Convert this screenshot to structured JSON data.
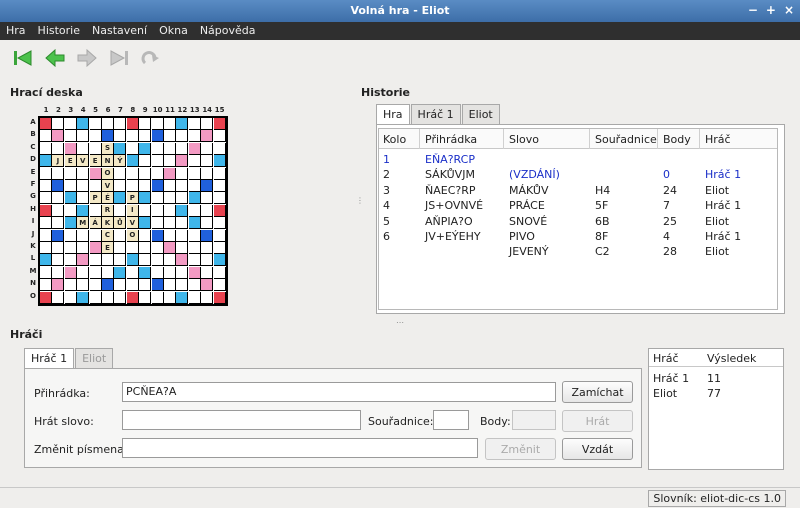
{
  "window": {
    "title": "Volná hra - Eliot"
  },
  "menu": [
    "Hra",
    "Historie",
    "Nastavení",
    "Okna",
    "Nápověda"
  ],
  "board_title": "Hrací deska",
  "history_title": "Historie",
  "players_title": "Hráči",
  "board": {
    "col_labels": [
      "1",
      "2",
      "3",
      "4",
      "5",
      "6",
      "7",
      "8",
      "9",
      "10",
      "11",
      "12",
      "13",
      "14",
      "15"
    ],
    "row_labels": [
      "A",
      "B",
      "C",
      "D",
      "E",
      "F",
      "G",
      "H",
      "I",
      "J",
      "K",
      "L",
      "M",
      "N",
      "O"
    ],
    "colors": {
      "tw": "#e8424f",
      "dw": "#f39ac3",
      "tl": "#2060dc",
      "dl": "#3fb6ea",
      "letter": "#f4e9c7"
    },
    "letters": [
      {
        "r": 2,
        "c": 5,
        "ch": "S"
      },
      {
        "r": 3,
        "c": 1,
        "ch": "J"
      },
      {
        "r": 3,
        "c": 2,
        "ch": "E"
      },
      {
        "r": 3,
        "c": 3,
        "ch": "V"
      },
      {
        "r": 3,
        "c": 4,
        "ch": "E"
      },
      {
        "r": 3,
        "c": 5,
        "ch": "N"
      },
      {
        "r": 3,
        "c": 6,
        "ch": "Ý"
      },
      {
        "r": 4,
        "c": 5,
        "ch": "O"
      },
      {
        "r": 5,
        "c": 5,
        "ch": "V"
      },
      {
        "r": 6,
        "c": 4,
        "ch": "P"
      },
      {
        "r": 6,
        "c": 5,
        "ch": "É"
      },
      {
        "r": 6,
        "c": 7,
        "ch": "P"
      },
      {
        "r": 7,
        "c": 5,
        "ch": "R"
      },
      {
        "r": 7,
        "c": 7,
        "ch": "I"
      },
      {
        "r": 8,
        "c": 3,
        "ch": "M"
      },
      {
        "r": 8,
        "c": 4,
        "ch": "Á"
      },
      {
        "r": 8,
        "c": 5,
        "ch": "K"
      },
      {
        "r": 8,
        "c": 6,
        "ch": "Ů"
      },
      {
        "r": 8,
        "c": 7,
        "ch": "V"
      },
      {
        "r": 9,
        "c": 5,
        "ch": "C"
      },
      {
        "r": 9,
        "c": 7,
        "ch": "O"
      },
      {
        "r": 10,
        "c": 5,
        "ch": "E"
      }
    ]
  },
  "history": {
    "tabs": [
      "Hra",
      "Hráč 1",
      "Eliot"
    ],
    "columns": [
      "Kolo",
      "Přihrádka",
      "Slovo",
      "Souřadnice",
      "Body",
      "Hráč"
    ],
    "rows": [
      {
        "kolo": "1",
        "rack": "EŇA?RCP",
        "word": "",
        "coord": "",
        "points": "",
        "player": "",
        "blue": true
      },
      {
        "kolo": "2",
        "rack": "SÁKŮVJM",
        "word": "(VZDÁNÍ)",
        "coord": "",
        "points": "0",
        "player": "Hráč 1",
        "blue_word": true
      },
      {
        "kolo": "3",
        "rack": "ŇAEC?RP",
        "word": "MÁKŮV",
        "coord": "H4",
        "points": "24",
        "player": "Eliot"
      },
      {
        "kolo": "4",
        "rack": "JS+OVNVÉ",
        "word": "PRÁCE",
        "coord": "5F",
        "points": "7",
        "player": "Hráč 1"
      },
      {
        "kolo": "5",
        "rack": "AŇPIA?O",
        "word": "SNOVÉ",
        "coord": "6B",
        "points": "25",
        "player": "Eliot"
      },
      {
        "kolo": "6",
        "rack": "JV+EÝEHY",
        "word": "PIVO",
        "coord": "8F",
        "points": "4",
        "player": "Hráč 1"
      },
      {
        "kolo": "",
        "rack": "",
        "word": "JEVENÝ",
        "coord": "C2",
        "points": "28",
        "player": "Eliot"
      }
    ]
  },
  "players": {
    "tabs": [
      "Hráč 1",
      "Eliot"
    ],
    "rack_label": "Přihrádka:",
    "rack_value": "PCŇEA?A",
    "shuffle_button": "Zamíchat",
    "play_label": "Hrát slovo:",
    "coord_label": "Souřadnice:",
    "points_label": "Body:",
    "play_button": "Hrát",
    "change_label": "Změnit písmena:",
    "change_button": "Změnit",
    "pass_button": "Vzdát"
  },
  "results": {
    "columns": [
      "Hráč",
      "Výsledek"
    ],
    "rows": [
      {
        "player": "Hráč 1",
        "score": "11"
      },
      {
        "player": "Eliot",
        "score": "77"
      }
    ]
  },
  "status": "Slovník: eliot-dic-cs 1.0"
}
